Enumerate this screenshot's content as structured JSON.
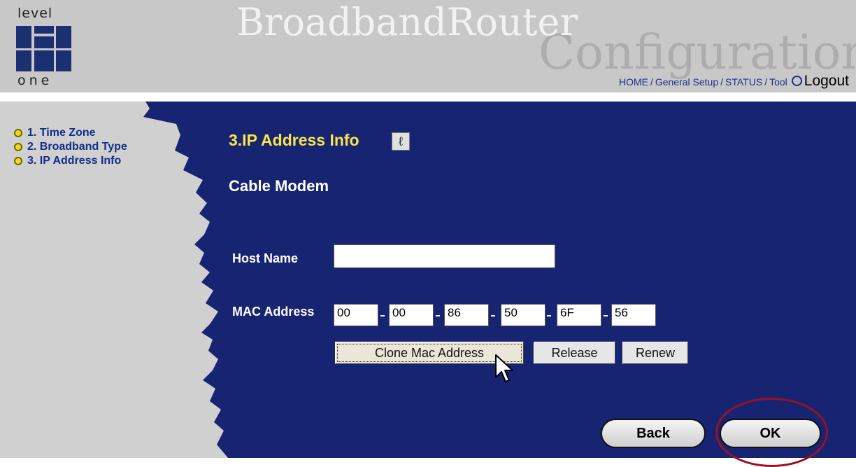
{
  "header": {
    "logo_top": "level",
    "logo_bottom": "one",
    "title": "BroadbandRouter",
    "subtitle": "Configuration",
    "nav": {
      "home": "HOME",
      "general_setup": "General Setup",
      "status": "STATUS",
      "tool": "Tool",
      "logout": "Logout"
    }
  },
  "sidebar": {
    "items": [
      {
        "label": "1. Time Zone"
      },
      {
        "label": "2. Broadband Type"
      },
      {
        "label": "3. IP Address Info"
      }
    ]
  },
  "main": {
    "section_title": "3.IP Address Info",
    "subtitle": "Cable Modem",
    "host_name_label": "Host Name",
    "host_name_value": "",
    "mac_label": "MAC Address",
    "mac_values": [
      "00",
      "00",
      "86",
      "50",
      "6F",
      "56"
    ],
    "buttons": {
      "clone": "Clone Mac Address",
      "release": "Release",
      "renew": "Renew",
      "back": "Back",
      "ok": "OK"
    }
  },
  "colors": {
    "panel": "#172471",
    "sidebar": "#d0d0d0",
    "header": "#c8c8c8",
    "title_accent": "#f9e64b",
    "highlight_ring": "#9b1024"
  }
}
